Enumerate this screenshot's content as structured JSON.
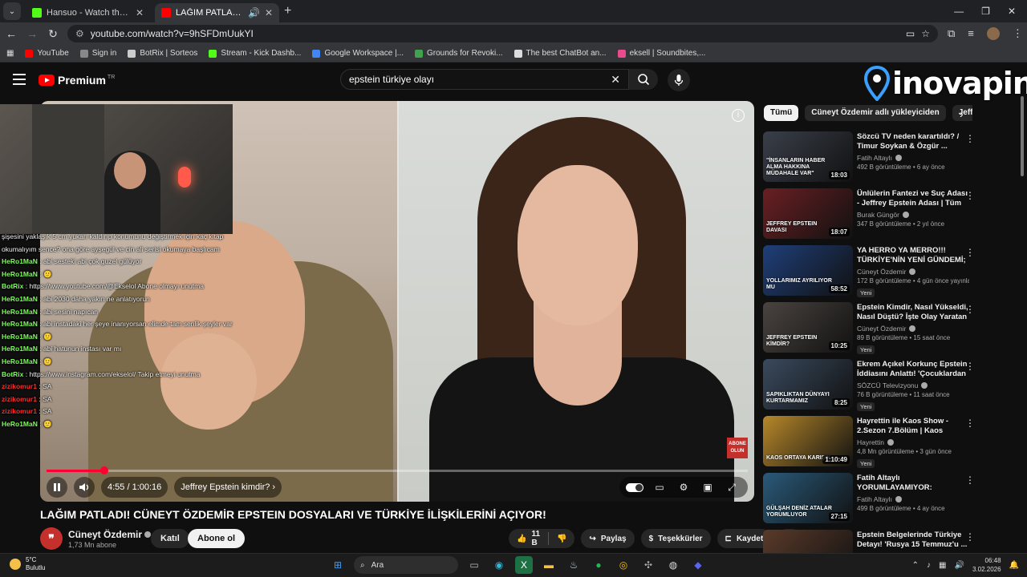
{
  "browser": {
    "tabs": [
      {
        "title": "Hansuo - Watch the VOD on Ki",
        "color": "#53fc18",
        "active": false
      },
      {
        "title": "LAĞIM PATLADI! CÜNEYT Ö",
        "color": "#ff0000",
        "active": true
      }
    ],
    "url": "youtube.com/watch?v=9hSFDmUukYI",
    "bookmarks": [
      {
        "label": "YouTube",
        "color": "#ff0000"
      },
      {
        "label": "Sign in",
        "color": "#888888"
      },
      {
        "label": "BotRix | Sorteos",
        "color": "#cccccc"
      },
      {
        "label": "Stream - Kick Dashb...",
        "color": "#53fc18"
      },
      {
        "label": "Google Workspace |...",
        "color": "#4285f4"
      },
      {
        "label": "Grounds for Revoki...",
        "color": "#3fa34d"
      },
      {
        "label": "The best ChatBot an...",
        "color": "#dddddd"
      },
      {
        "label": "eksell | Soundbites,...",
        "color": "#e94b8c"
      }
    ]
  },
  "youtube": {
    "brand": "Premium",
    "brand_sup": "TR",
    "search_query": "epstein türkiye olayı"
  },
  "watermark": {
    "text": "inovapin"
  },
  "player": {
    "time": "4:55 / 1:00:16",
    "chapter": "Jeffrey Epstein kimdir?",
    "progress": 0.082,
    "abone_badge": "ABONE OLUN"
  },
  "chat": [
    {
      "user": "",
      "msg": "şişesini yaklaşık 5 cm yukarı kaldırıp konumunu değiştirmek için kaç kitap",
      "color": "#ffffff"
    },
    {
      "user": "",
      "msg": "okumalıyım sence? ona göre ayşegül ve cin ali serisi okumaya başlıcam",
      "color": "#ffffff"
    },
    {
      "user": "HeRo1MaN",
      "msg": ": abi sesteki abi çok guzel gülüyor",
      "color": "#7cff5a"
    },
    {
      "user": "HeRo1MaN",
      "msg": ": 🙂",
      "color": "#7cff5a"
    },
    {
      "user": "BotRix",
      "msg": ": https://www.youtube.com/@Ekselol Abone olmayı unutma",
      "color": "#7cff5a"
    },
    {
      "user": "HeRo1MaN",
      "msg": ": abi 2030 daha yakın ne anlatıyorun",
      "color": "#7cff5a"
    },
    {
      "user": "HeRo1MaN",
      "msg": ": abi sesini napıcan",
      "color": "#7cff5a"
    },
    {
      "user": "HeRo1MaN",
      "msg": ": abi instadaki her şeye inanıyorsan elimde tam senlik şeyler var",
      "color": "#7cff5a"
    },
    {
      "user": "HeRo1MaN",
      "msg": ": 🙂",
      "color": "#7cff5a"
    },
    {
      "user": "HeRo1MaN",
      "msg": ": abi hatunun instası var mı",
      "color": "#7cff5a"
    },
    {
      "user": "HeRo1MaN",
      "msg": ": 🙂",
      "color": "#7cff5a"
    },
    {
      "user": "BotRix",
      "msg": ": https://www.instagram.com/ekselol/ Takip etmeyi unutma",
      "color": "#7cff5a"
    },
    {
      "user": "zizikomur1",
      "msg": ": SA",
      "color": "#ff2b2b"
    },
    {
      "user": "zizikomur1",
      "msg": ": SA",
      "color": "#ff2b2b"
    },
    {
      "user": "zizikomur1",
      "msg": ": SA",
      "color": "#ff2b2b"
    },
    {
      "user": "HeRo1MaN",
      "msg": ": 🙂",
      "color": "#7cff5a"
    }
  ],
  "video": {
    "title": "LAĞIM PATLADI! CÜNEYT ÖZDEMİR EPSTEIN DOSYALARI VE TÜRKİYE İLİŞKİLERİNİ AÇIYOR!",
    "channel": "Cüneyt Özdemir",
    "subs": "1,73 Mn abone",
    "join": "Katıl",
    "subscribe": "Abone ol",
    "likes": "11 B",
    "share": "Paylaş",
    "thanks": "Teşekkürler",
    "save": "Kaydet"
  },
  "chips": [
    "Tümü",
    "Cüneyt Özdemir adlı yükleyiciden",
    "Jeffrey Epstein"
  ],
  "related": [
    {
      "title": "Sözcü TV neden karartıldı? / Timur Soykan & Özgür ...",
      "channel": "Fatih Altaylı",
      "views": "492 B görüntüleme • 6 ay önce",
      "duration": "18:03",
      "caption": "\"İNSANLARIN HABER ALMA HAKKINA MÜDAHALE VAR\"",
      "bg": "#3a3f4a",
      "isnew": ""
    },
    {
      "title": "Ünlülerin Fantezi ve Suç Adası - Jeffrey Epstein Adası | Tüm ...",
      "channel": "Burak Güngör",
      "views": "347 B görüntüleme • 2 yıl önce",
      "duration": "18:07",
      "caption": "JEFFREY EPSTEIN DAVASI",
      "bg": "#6a1f22",
      "isnew": ""
    },
    {
      "title": "YA HERRO YA MERRO!!! TÜRKİYE'NİN YENİ GÜNDEMİ; ...",
      "channel": "Cüneyt Özdemir",
      "views": "172 B görüntüleme • 4 gün önce yayınlan...",
      "duration": "58:52",
      "caption": "YOLLARIMIZ AYRILIYOR MU",
      "bg": "#1f3f7a",
      "isnew": "Yeni"
    },
    {
      "title": "Epstein Kimdir, Nasıl Yükseldi, Nasıl Düştü? İşte Olay Yaratan ...",
      "channel": "Cüneyt Özdemir",
      "views": "89 B görüntüleme • 15 saat önce",
      "duration": "10:25",
      "caption": "JEFFREY EPSTEIN KİMDİR?",
      "bg": "#4a4440",
      "isnew": "Yeni"
    },
    {
      "title": "Ekrem Açıkel Korkunç Epstein İddiasını Anlattı! 'Çocuklardan ...",
      "channel": "SÖZCÜ Televizyonu",
      "views": "76 B görüntüleme • 11 saat önce",
      "duration": "8:25",
      "caption": "SAPIKLIKTAN DÜNYAYI KURTARMAMIZ",
      "bg": "#3a4a5e",
      "isnew": "Yeni"
    },
    {
      "title": "Hayrettin ile Kaos Show - 2.Sezon 7.Bölüm | Kaos Ortay...",
      "channel": "Hayrettin",
      "views": "4,8 Mn görüntüleme • 3 gün önce",
      "duration": "1:10:49",
      "caption": "KAOS ORTAYA KARIŞIK",
      "bg": "#b7882a",
      "isnew": "Yeni"
    },
    {
      "title": "Fatih Altaylı YORUMLAYAMIYOR: \"Randevu...",
      "channel": "Fatih Altaylı",
      "views": "499 B görüntüleme • 4 ay önce",
      "duration": "27:15",
      "caption": "GÜLŞAH DENİZ ATALAR YORUMLUYOR",
      "bg": "#2a5a7a",
      "isnew": ""
    },
    {
      "title": "Epstein Belgelerinde Türkiye Detayı! 'Rusya 15 Temmuz'u ...",
      "channel": "",
      "views": "",
      "duration": "",
      "caption": "",
      "bg": "#5a3a2a",
      "isnew": ""
    }
  ],
  "taskbar": {
    "temp": "5°C",
    "weather": "Bulutlu",
    "search": "Ara",
    "time": "06:48",
    "date": "3.02.2026"
  }
}
